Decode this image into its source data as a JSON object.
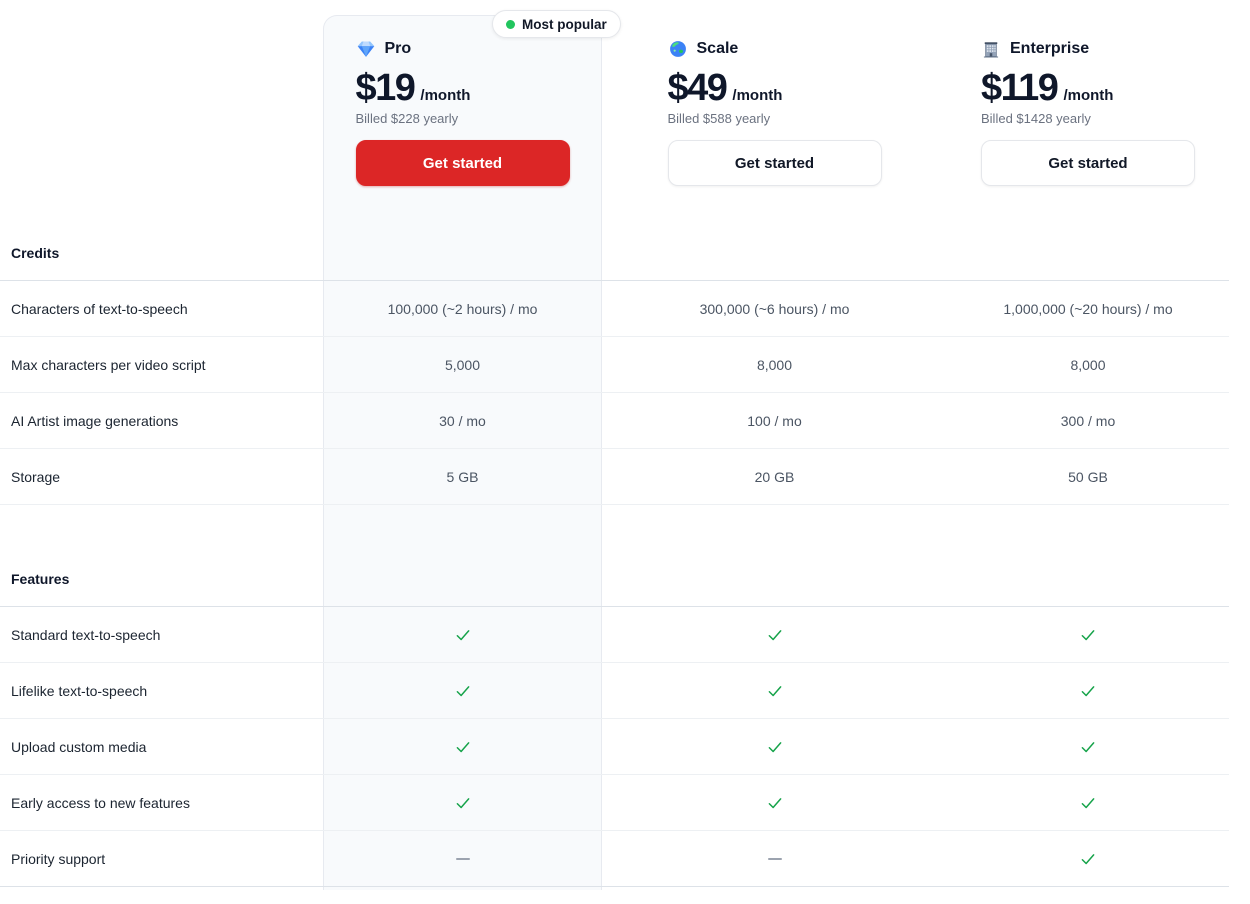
{
  "badge": {
    "label": "Most popular"
  },
  "plans": [
    {
      "name": "Pro",
      "icon": "diamond-icon",
      "price": "$19",
      "period": "/month",
      "billed": "Billed $228 yearly",
      "cta": "Get started",
      "highlight": true
    },
    {
      "name": "Scale",
      "icon": "globe-icon",
      "price": "$49",
      "period": "/month",
      "billed": "Billed $588 yearly",
      "cta": "Get started",
      "highlight": false
    },
    {
      "name": "Enterprise",
      "icon": "building-icon",
      "price": "$119",
      "period": "/month",
      "billed": "Billed $1428 yearly",
      "cta": "Get started",
      "highlight": false
    }
  ],
  "sections": [
    {
      "title": "Credits",
      "rows": [
        {
          "label": "Characters of text-to-speech",
          "values": [
            "100,000 (~2 hours) / mo",
            "300,000 (~6 hours) / mo",
            "1,000,000 (~20 hours) / mo"
          ]
        },
        {
          "label": "Max characters per video script",
          "values": [
            "5,000",
            "8,000",
            "8,000"
          ]
        },
        {
          "label": "AI Artist image generations",
          "values": [
            "30 / mo",
            "100 / mo",
            "300 / mo"
          ]
        },
        {
          "label": "Storage",
          "values": [
            "5 GB",
            "20 GB",
            "50 GB"
          ]
        }
      ]
    },
    {
      "title": "Features",
      "rows": [
        {
          "label": "Standard text-to-speech",
          "values": [
            "check",
            "check",
            "check"
          ]
        },
        {
          "label": "Lifelike text-to-speech",
          "values": [
            "check",
            "check",
            "check"
          ]
        },
        {
          "label": "Upload custom media",
          "values": [
            "check",
            "check",
            "check"
          ]
        },
        {
          "label": "Early access to new features",
          "values": [
            "check",
            "check",
            "check"
          ]
        },
        {
          "label": "Priority support",
          "values": [
            "dash",
            "dash",
            "check"
          ]
        }
      ]
    }
  ],
  "colors": {
    "accent_red": "#dc2626",
    "check_green": "#16a34a",
    "dash_gray": "#9ca3af",
    "badge_dot_green": "#22c55e",
    "highlight_bg": "#f8fafc"
  }
}
